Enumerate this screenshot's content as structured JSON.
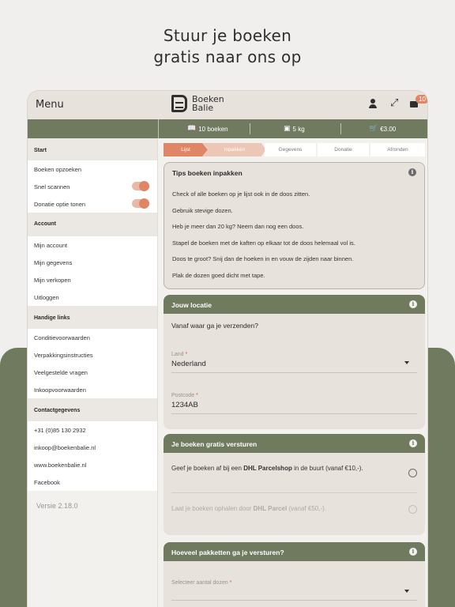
{
  "hero": {
    "line1": "Stuur je boeken",
    "line2": "gratis naar ons op"
  },
  "topbar": {
    "menu_title": "Menu",
    "logo_line1": "Boeken",
    "logo_line2": "Balie",
    "cart_badge": "10"
  },
  "status": {
    "books": "10 boeken",
    "weight": "5 kg",
    "price": "€3.00"
  },
  "sidebar": {
    "start_head": "Start",
    "search": "Boeken opzoeken",
    "quick_scan": "Snel scannen",
    "donation_toggle": "Donatie optie tonen",
    "account_head": "Account",
    "my_account": "Mijn account",
    "my_details": "Mijn gegevens",
    "my_sales": "Mijn verkopen",
    "logout": "Uitloggen",
    "links_head": "Handige links",
    "terms": "Conditievoorwaarden",
    "packing": "Verpakkingsinstructies",
    "faq": "Veelgestelde vragen",
    "purchase_terms": "Inkoopvoorwaarden",
    "contact_head": "Contactgegevens",
    "phone": "+31 (0)85 130 2932",
    "email": "inkoop@boekenbalie.nl",
    "website": "www.boekenbalie.nl",
    "facebook": "Facebook",
    "version": "Versie 2.18.0"
  },
  "steps": [
    "Lijst",
    "Inpakken",
    "Gegevens",
    "Donatie",
    "Afronden"
  ],
  "tips": {
    "title": "Tips boeken inpakken",
    "items": [
      "Check of alle boeken op je lijst ook in de doos zitten.",
      "Gebruik stevige dozen.",
      "Heb je meer dan 20 kg? Neem dan nog een doos.",
      "Stapel de boeken met de kaften op elkaar tot de doos helemaal vol is.",
      "Doos te groot? Snij dan de hoeken in en vouw de zijden naar binnen.",
      "Plak de dozen goed dicht met tape."
    ]
  },
  "location": {
    "title": "Jouw locatie",
    "question": "Vanaf waar ga je verzenden?",
    "country_label": "Land",
    "country_value": "Nederland",
    "postcode_label": "Postcode",
    "postcode_value": "1234AB"
  },
  "shipping": {
    "title": "Je boeken gratis versturen",
    "option1_pre": "Geef je boeken af bij een ",
    "option1_bold": "DHL Parcelshop",
    "option1_post": " in de buurt (vanaf €10,-).",
    "option2_pre": "Laat je boeken ophalen door ",
    "option2_bold": "DHL Parcel",
    "option2_post": " (vanaf €50,-)."
  },
  "packages": {
    "title": "Hoeveel pakketten ga je versturen?",
    "select_label": "Selecteer aantal dozen"
  },
  "colors": {
    "olive": "#6f7a5f",
    "accent": "#e08565",
    "card": "#e8e2dc"
  }
}
